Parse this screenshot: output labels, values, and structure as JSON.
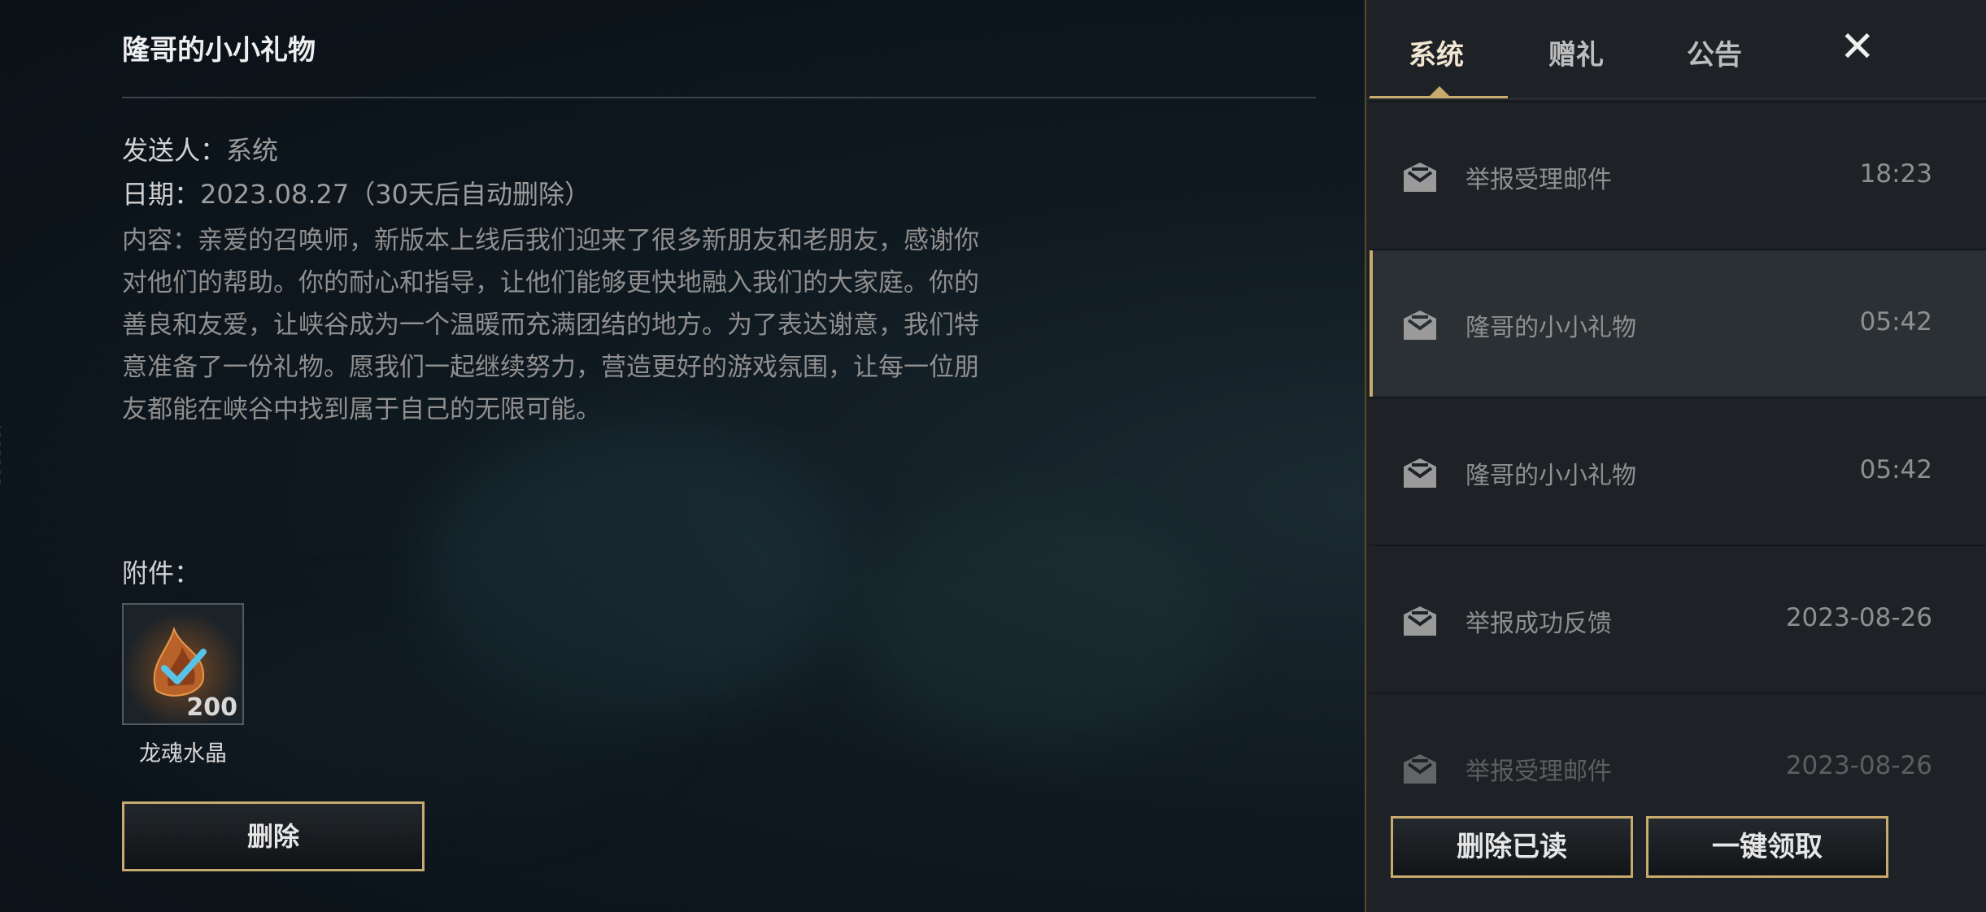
{
  "detail": {
    "title": "隆哥的小小礼物",
    "sender_label": "发送人：",
    "sender_value": "系统",
    "date_label": "日期：",
    "date_value": "2023.08.27（30天后自动删除）",
    "content_lines": [
      "内容：亲爱的召唤师，新版本上线后我们迎来了很多新朋友和老朋友，感谢你",
      "对他们的帮助。你的耐心和指导，让他们能够更快地融入我们的大家庭。你的",
      "善良和友爱，让峡谷成为一个温暖而充满团结的地方。为了表达谢意，我们特",
      "意准备了一份礼物。愿我们一起继续努力，营造更好的游戏氛围，让每一位朋",
      "友都能在峡谷中找到属于自己的无限可能。"
    ],
    "attachment_label": "附件：",
    "attachment": {
      "name": "龙魂水晶",
      "count": "200",
      "icon": "dragon-soul-crystal-icon"
    },
    "delete_label": "删除"
  },
  "panel": {
    "tabs": [
      {
        "label": "系统",
        "active": true
      },
      {
        "label": "赠礼"
      },
      {
        "label": "公告"
      }
    ],
    "close_icon": "close-icon",
    "mails": [
      {
        "subject": "举报受理邮件",
        "time": "18:23"
      },
      {
        "subject": "隆哥的小小礼物",
        "time": "05:42",
        "selected": true
      },
      {
        "subject": "隆哥的小小礼物",
        "time": "05:42"
      },
      {
        "subject": "举报成功反馈",
        "time": "2023-08-26"
      },
      {
        "subject": "举报受理邮件",
        "time": "2023-08-26"
      }
    ],
    "delete_read_label": "删除已读",
    "claim_all_label": "一键领取"
  },
  "side_id": "4902108",
  "colors": {
    "accent_gold": "#c8aa6e",
    "panel_bg": "#1e2226",
    "selected_bg": "#2b3034"
  }
}
